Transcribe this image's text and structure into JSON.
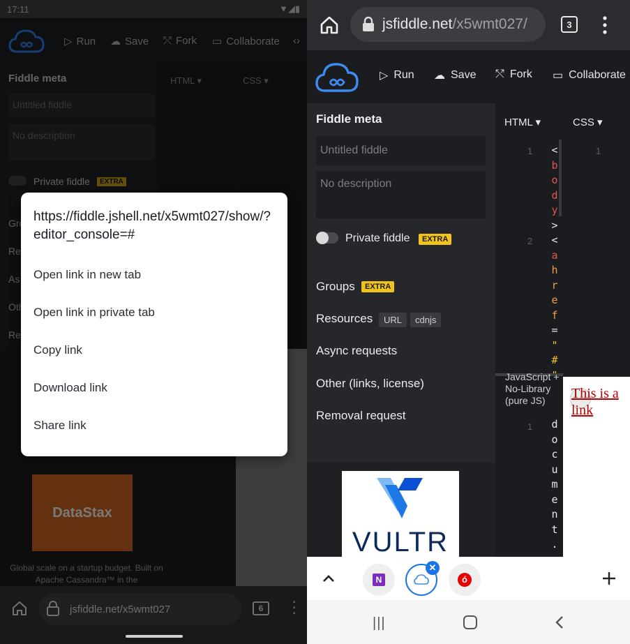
{
  "left": {
    "status_time": "17:11",
    "toolbar": {
      "run": "Run",
      "save": "Save",
      "fork": "Fork",
      "collaborate": "Collaborate"
    },
    "meta_title": "Fiddle meta",
    "col_html": "HTML ▾",
    "col_css": "CSS ▾",
    "name_placeholder": "Untitled fiddle",
    "desc_placeholder": "No description",
    "private_label": "Private fiddle",
    "extra_badge": "EXTRA",
    "partial_items": [
      "Gro",
      "Re",
      "As",
      "Oth",
      "Re"
    ],
    "ad_brand": "DataStax",
    "ad_text": "Global scale on a startup budget. Built on Apache Cassandra™ in the",
    "url": "jsfiddle.net/x5wmt027",
    "tab_count": "6"
  },
  "context_menu": {
    "url": "https://fiddle.jshell.net/x5wmt027/show/?editor_console=#",
    "items": [
      "Open link in new tab",
      "Open link in private tab",
      "Copy link",
      "Download link",
      "Share link"
    ]
  },
  "right": {
    "url_host": "jsfiddle.net",
    "url_path": "/x5wmt027/",
    "tab_count": "3",
    "toolbar": {
      "run": "Run",
      "save": "Save",
      "fork": "Fork",
      "collaborate": "Collaborate"
    },
    "meta_title": "Fiddle meta",
    "name_placeholder": "Untitled fiddle",
    "desc_placeholder": "No description",
    "private_label": "Private fiddle",
    "extra_badge": "EXTRA",
    "groups_label": "Groups",
    "resources_label": "Resources",
    "chip_url": "URL",
    "chip_cdnjs": "cdnjs",
    "async_label": "Async requests",
    "other_label": "Other (links, license)",
    "removal_label": "Removal request",
    "ad_brand": "VULTR",
    "col_html": "HTML ▾",
    "col_css": "CSS ▾",
    "line_1": "1",
    "line_2": "2",
    "html_code_line1": [
      "<",
      "b",
      "o",
      "d",
      "y",
      ">"
    ],
    "html_code_line2": [
      "<",
      "a",
      "h",
      "r",
      "e",
      "f",
      "=",
      "\"",
      "#",
      "\""
    ],
    "js_header": "JavaScript + No-Library (pure JS)",
    "js_code": [
      "d",
      "o",
      "c",
      "u",
      "m",
      "e",
      "n",
      "t",
      "."
    ],
    "result_link": "This is a link",
    "accent_blue": "#1a73e8",
    "extra_yellow": "#f2c21c",
    "link_red": "#c00000"
  }
}
